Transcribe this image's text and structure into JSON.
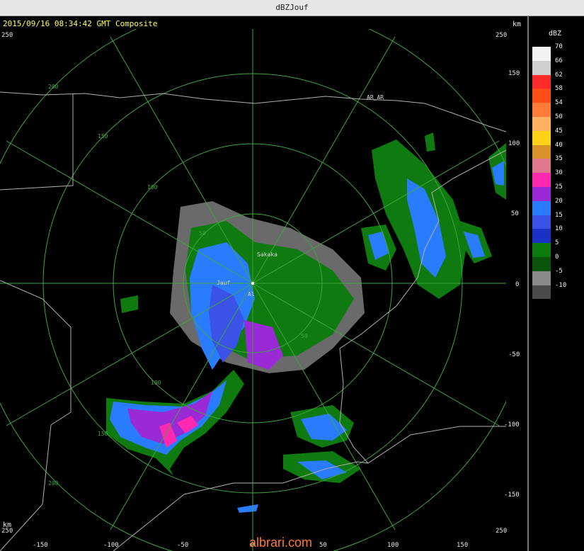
{
  "window": {
    "title": "dBZJouf"
  },
  "header": {
    "timestamp_text": "2015/09/16 08:34:42 GMT Composite"
  },
  "units": {
    "km_top": "km",
    "km_bottom": "km"
  },
  "legend": {
    "title": "dBZ",
    "entries": [
      {
        "label": "70",
        "color": "#f2f2f2"
      },
      {
        "label": "66",
        "color": "#cfcfcf"
      },
      {
        "label": "62",
        "color": "#ff2a2a"
      },
      {
        "label": "58",
        "color": "#ff4e18"
      },
      {
        "label": "54",
        "color": "#ff7b3a"
      },
      {
        "label": "50",
        "color": "#ffb060"
      },
      {
        "label": "45",
        "color": "#ffd21a"
      },
      {
        "label": "40",
        "color": "#d9922a"
      },
      {
        "label": "35",
        "color": "#e07890"
      },
      {
        "label": "30",
        "color": "#ff2ab0"
      },
      {
        "label": "25",
        "color": "#9a2ad6"
      },
      {
        "label": "20",
        "color": "#2a7cff"
      },
      {
        "label": "15",
        "color": "#3a52e6"
      },
      {
        "label": "10",
        "color": "#1a32c4"
      },
      {
        "label": "5",
        "color": "#0f7a0f"
      },
      {
        "label": "0",
        "color": "#0b540b"
      },
      {
        "label": "-5",
        "color": "#8a8a8a"
      },
      {
        "label": "-10",
        "color": "#4a4a4a"
      }
    ]
  },
  "axes": {
    "x_ticks": [
      "-150",
      "-100",
      "-50",
      "0",
      "50",
      "100",
      "150"
    ],
    "y_ticks": [
      "150",
      "100",
      "50",
      "0",
      "-50",
      "-100",
      "-150"
    ],
    "corner_labels": [
      "250",
      "250",
      "250",
      "250"
    ]
  },
  "range_rings": {
    "labels_upper": [
      "50",
      "100",
      "150",
      "200"
    ],
    "labels_lower": [
      "50",
      "100",
      "150",
      "200"
    ]
  },
  "places": {
    "radar_site": "Al",
    "town1": "Jauf",
    "town2": "Sakaka",
    "region": "AR_AR"
  },
  "watermark": "albrari.com"
}
